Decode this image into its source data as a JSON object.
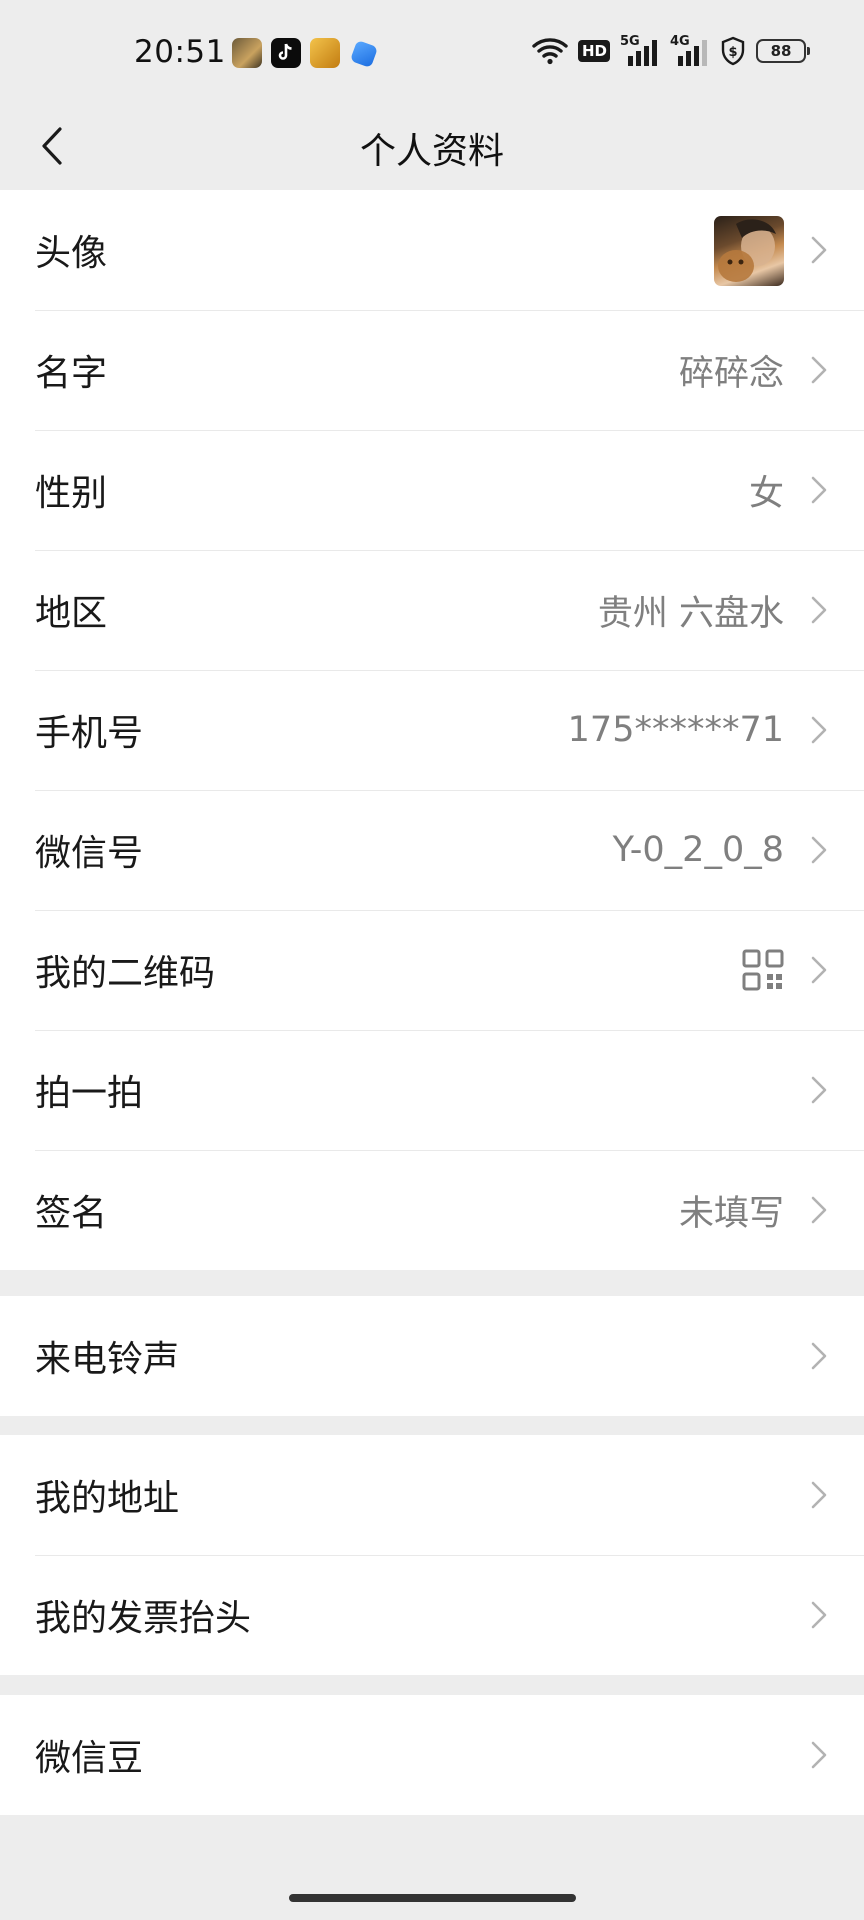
{
  "status_bar": {
    "time": "20:51",
    "hd_label": "HD",
    "net1": "5G",
    "net2": "4G",
    "battery": "88",
    "app_icons": [
      "pubg-icon",
      "tiktok-icon",
      "game-icon",
      "feather-icon"
    ]
  },
  "header": {
    "title": "个人资料",
    "back_icon": "chevron-left-icon"
  },
  "profile": {
    "avatar_label": "头像",
    "name_label": "名字",
    "name_value": "碎碎念",
    "gender_label": "性别",
    "gender_value": "女",
    "region_label": "地区",
    "region_value": "贵州 六盘水",
    "phone_label": "手机号",
    "phone_value": "175******71",
    "wechat_id_label": "微信号",
    "wechat_id_value": "Y-0_2_0_8",
    "qrcode_label": "我的二维码",
    "pat_label": "拍一拍",
    "signature_label": "签名",
    "signature_value": "未填写"
  },
  "ringtone": {
    "label": "来电铃声"
  },
  "address": {
    "my_address_label": "我的地址",
    "invoice_label": "我的发票抬头"
  },
  "beans": {
    "label": "微信豆"
  },
  "colors": {
    "background": "#ededed",
    "cell": "#ffffff",
    "text": "#191919",
    "secondary_text": "#7f7f7f",
    "divider": "#e9e9e9"
  }
}
